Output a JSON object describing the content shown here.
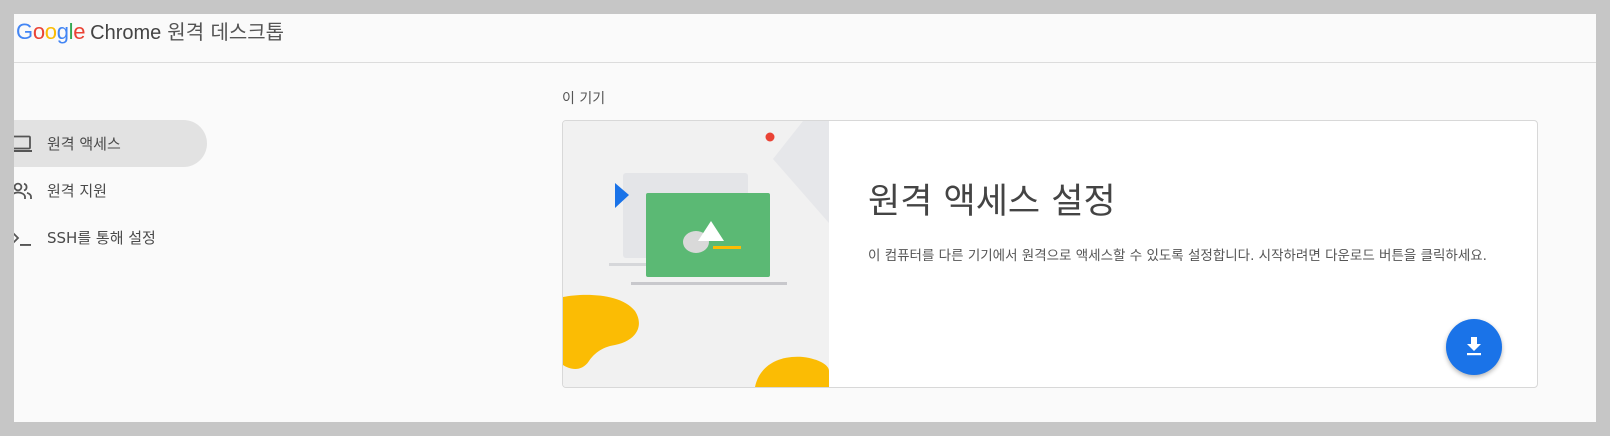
{
  "header": {
    "brand": "Google",
    "product": "Chrome",
    "app_name": "원격 데스크톱",
    "brand_colors": [
      "#4285F4",
      "#EA4335",
      "#FBBC05",
      "#4285F4",
      "#34A853",
      "#EA4335"
    ]
  },
  "sidebar": {
    "items": [
      {
        "label": "원격 액세스",
        "icon": "laptop-icon",
        "active": true
      },
      {
        "label": "원격 지원",
        "icon": "people-icon",
        "active": false
      },
      {
        "label": "SSH를 통해 설정",
        "icon": "terminal-icon",
        "active": false
      }
    ]
  },
  "main": {
    "section_label": "이 기기",
    "card": {
      "title": "원격 액세스 설정",
      "description": "이 컴퓨터를 다른 기기에서 원격으로 액세스할 수 있도록 설정합니다. 시작하려면 다운로드 버튼을 클릭하세요.",
      "button_icon": "download-icon"
    }
  },
  "colors": {
    "accent": "#1a73e8",
    "sidebar_active_bg": "#e2e2e2",
    "illustration_green": "#5bb974",
    "illustration_yellow": "#fbbc04",
    "illustration_blue": "#1a73e8",
    "illustration_red": "#ea4335"
  }
}
